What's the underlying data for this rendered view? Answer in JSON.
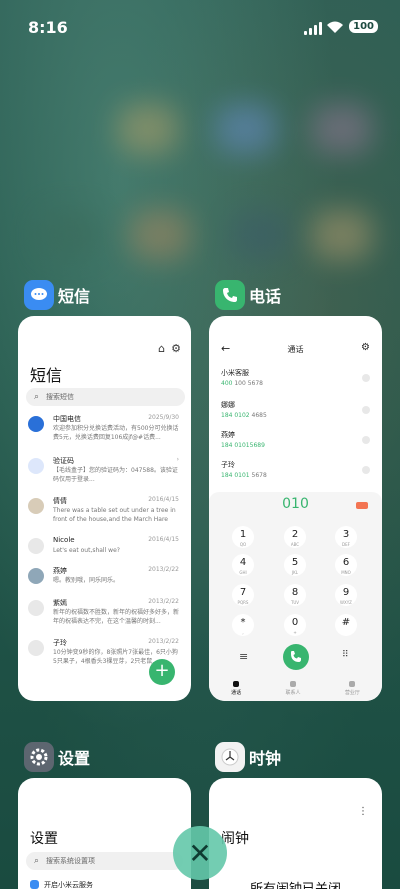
{
  "status_bar": {
    "time": "8:16",
    "battery": "100"
  },
  "apps": {
    "sms": {
      "label": "短信",
      "title": "短信",
      "search_placeholder": "搜索短信",
      "messages": [
        {
          "name": "中国电信",
          "date": "2025/9/30",
          "body": "欢迎参加积分兑换话费活动，有500分可兑换话费5元，兑换话费回复106成jf@#话费..."
        },
        {
          "name": "验证码",
          "date": "",
          "body": "【毛线盒子】您的验证码为：047588。该验证码仅用于登录..."
        },
        {
          "name": "倩倩",
          "date": "2016/4/15",
          "body": "There was a table set out under a tree in front of the house,and the March Hare an..."
        },
        {
          "name": "Nicole",
          "date": "2016/4/15",
          "body": "Let's eat out,shall we?"
        },
        {
          "name": "燕婷",
          "date": "2013/2/22",
          "body": "嗯。教别哦，同乐同乐。"
        },
        {
          "name": "紫嫣",
          "date": "2013/2/22",
          "body": "新年的祝福数不胜数，新年的祝福好多好多，新年的祝福表达不完，在这个温馨的时刻..."
        },
        {
          "name": "子玲",
          "date": "2013/2/22",
          "body": "10分钟变9秒的你，8张照片7张最佳，6只小狗5只果子，4根香头3棵豆芽，2只老鼠..."
        }
      ]
    },
    "phone": {
      "label": "电话",
      "header": "通话",
      "contacts": [
        {
          "name": "小米客服",
          "num_hl": "400",
          "num_rest": " 100 5678"
        },
        {
          "name": "娜娜",
          "num_hl": "184 0102",
          "num_rest": " 4685"
        },
        {
          "name": "燕婷",
          "num_hl": "184 01015689",
          "num_rest": ""
        },
        {
          "name": "子玲",
          "num_hl": "184 0101",
          "num_rest": " 5678"
        }
      ],
      "dialed": "010",
      "keys": [
        {
          "d": "1",
          "l": "QO"
        },
        {
          "d": "2",
          "l": "ABC"
        },
        {
          "d": "3",
          "l": "DEF"
        },
        {
          "d": "4",
          "l": "GHI"
        },
        {
          "d": "5",
          "l": "JKL"
        },
        {
          "d": "6",
          "l": "MNO"
        },
        {
          "d": "7",
          "l": "PQRS"
        },
        {
          "d": "8",
          "l": "TUV"
        },
        {
          "d": "9",
          "l": "WXYZ"
        },
        {
          "d": "*",
          "l": ","
        },
        {
          "d": "0",
          "l": "+"
        },
        {
          "d": "#",
          "l": ""
        }
      ],
      "tabs": [
        "通话",
        "联系人",
        "营业厅"
      ]
    },
    "settings": {
      "label": "设置",
      "title": "设置",
      "search_placeholder": "搜索系统设置项",
      "row": "开启小米云服务"
    },
    "clock": {
      "label": "时钟",
      "title": "闹钟",
      "message": "所有闹钟已关闭"
    }
  },
  "colors": {
    "accent_green": "#38b56f",
    "delete_red": "#f37452",
    "sms_icon": "#3a8cf2"
  }
}
